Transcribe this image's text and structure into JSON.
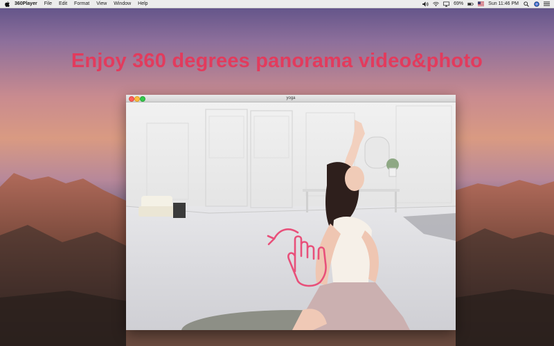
{
  "menubar": {
    "app_name": "360Player",
    "menus": [
      "File",
      "Edit",
      "Format",
      "View",
      "Window",
      "Help"
    ],
    "battery": "69%",
    "clock": "Sun 11:46 PM",
    "icons": [
      "apple-icon",
      "volume-icon",
      "wifi-icon",
      "airplay-icon",
      "battery-icon",
      "flag-icon",
      "search-icon",
      "siri-icon",
      "list-icon"
    ]
  },
  "headline": "Enjoy 360 degrees panorama video&photo",
  "player": {
    "window_title": "yoga",
    "gesture_icon": "hand-drag-rotate-icon"
  },
  "colors": {
    "headline": "#e23b5d",
    "gesture": "#e8507a"
  }
}
